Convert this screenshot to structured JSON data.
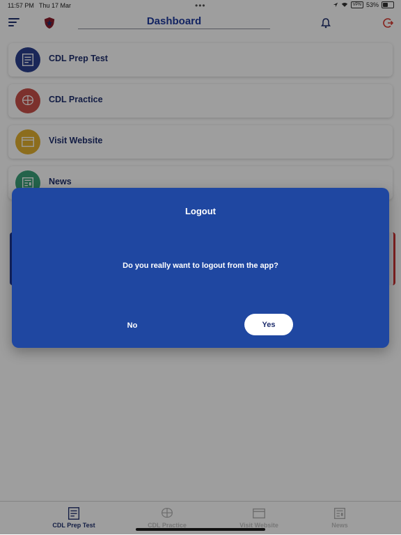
{
  "status_bar": {
    "time": "11:57 PM",
    "date": "Thu 17 Mar",
    "vpn": "VPN",
    "battery": "53%",
    "battery_level": 0.53
  },
  "header": {
    "title": "Dashboard",
    "icons": [
      "menu-icon",
      "shield-icon",
      "bell-icon",
      "logout-icon"
    ]
  },
  "menu": [
    {
      "label": "CDL Prep Test",
      "icon": "test-sheet-icon",
      "color": "#2b3f8f"
    },
    {
      "label": "CDL Practice",
      "icon": "brain-icon",
      "color": "#c9504a"
    },
    {
      "label": "Visit Website",
      "icon": "browser-icon",
      "color": "#e2b030"
    },
    {
      "label": "News",
      "icon": "newspaper-icon",
      "color": "#3aa07a"
    }
  ],
  "dialog": {
    "title": "Logout",
    "message": "Do you really want to logout from the app?",
    "no_label": "No",
    "yes_label": "Yes",
    "background": "#1f47a1"
  },
  "tabs": [
    {
      "label": "CDL Prep Test",
      "icon": "test-sheet-icon",
      "active": true
    },
    {
      "label": "CDL Practice",
      "icon": "brain-icon",
      "active": false
    },
    {
      "label": "Visit Website",
      "icon": "browser-icon",
      "active": false
    },
    {
      "label": "News",
      "icon": "newspaper-icon",
      "active": false
    }
  ]
}
